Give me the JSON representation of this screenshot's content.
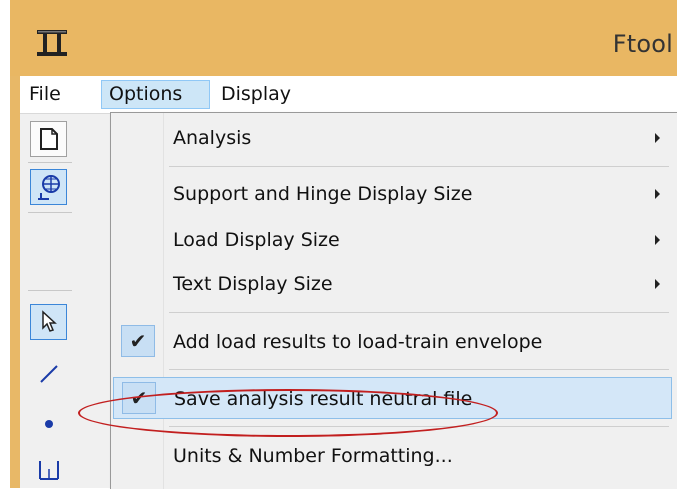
{
  "window": {
    "title": "Ftool",
    "icon": "ftool-icon"
  },
  "menubar": {
    "items": [
      {
        "label": "File"
      },
      {
        "label": "Options",
        "active": true
      },
      {
        "label": "Display"
      }
    ]
  },
  "toolbar": {
    "buttons": [
      {
        "icon": "new-file-icon"
      },
      {
        "icon": "grid-snap-icon",
        "active": true
      },
      {
        "icon": "select-arrow-icon",
        "active": true
      },
      {
        "icon": "draw-line-icon"
      },
      {
        "icon": "node-point-icon"
      },
      {
        "icon": "support-icon"
      }
    ]
  },
  "options_menu": {
    "items": [
      {
        "label": "Analysis",
        "submenu": true,
        "checked": false
      },
      {
        "label": "Support and Hinge Display Size",
        "submenu": true,
        "checked": false
      },
      {
        "label": "Load Display Size",
        "submenu": true,
        "checked": false
      },
      {
        "label": "Text Display Size",
        "submenu": true,
        "checked": false
      },
      {
        "label": "Add load results to load-train envelope",
        "submenu": false,
        "checked": true
      },
      {
        "label": "Save analysis result neutral file",
        "submenu": false,
        "checked": true,
        "highlighted": true
      },
      {
        "label": "Units & Number Formatting...",
        "submenu": false,
        "checked": false
      }
    ],
    "check_glyph": "✔"
  },
  "colors": {
    "window_border": "#e9b763",
    "menu_highlight": "#d4e7f8",
    "annotation_circle": "#c21f1f"
  }
}
